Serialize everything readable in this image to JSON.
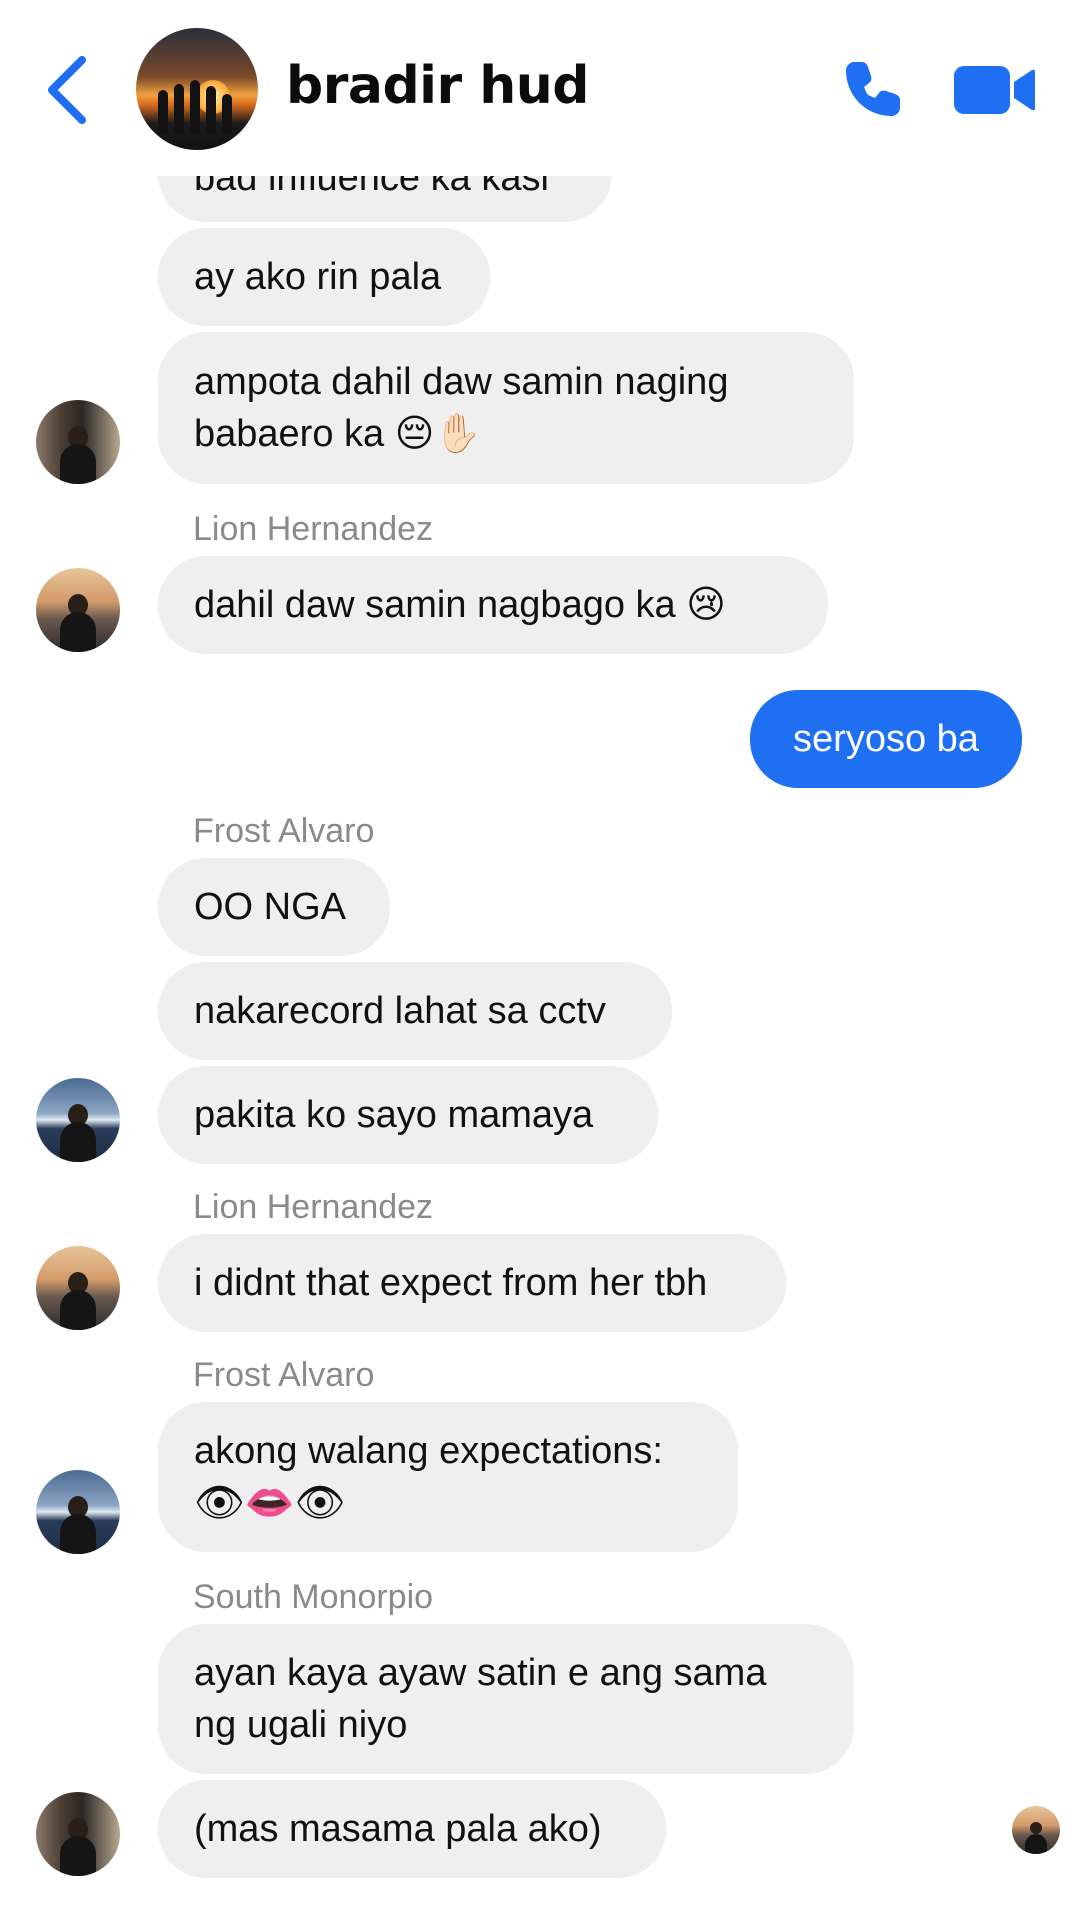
{
  "header": {
    "title": "bradir hud",
    "back_icon": "chevron-left-icon",
    "call_icon": "phone-icon",
    "video_icon": "video-camera-icon",
    "accent": "#1f6ff2"
  },
  "messages": [
    {
      "text": "bad influence ka kasi"
    },
    {
      "text": "ay ako rin pala"
    },
    {
      "line1": "ampota dahil daw samin naging",
      "line2": "babaero ka 😔✋🏻"
    },
    {
      "sender": "Lion Hernandez",
      "text": "dahil daw samin nagbago ka 😢"
    },
    {
      "text": "seryoso ba"
    },
    {
      "sender": "Frost Alvaro",
      "text": "OO NGA"
    },
    {
      "text": "nakarecord lahat sa cctv"
    },
    {
      "text": "pakita ko sayo mamaya"
    },
    {
      "sender": "Lion Hernandez",
      "text": "i didnt that expect from her tbh"
    },
    {
      "sender": "Frost Alvaro",
      "line1": "akong walang expectations:",
      "line2": "👁👄👁"
    },
    {
      "sender": "South Monorpio",
      "line1": "ayan kaya ayaw satin e ang sama",
      "line2": "ng ugali niyo"
    },
    {
      "text": "(mas masama pala ako)"
    }
  ],
  "colors": {
    "incoming_bubble": "#efefef",
    "outgoing_bubble": "#1f6ff2",
    "sender_name": "#8a8a8a"
  }
}
